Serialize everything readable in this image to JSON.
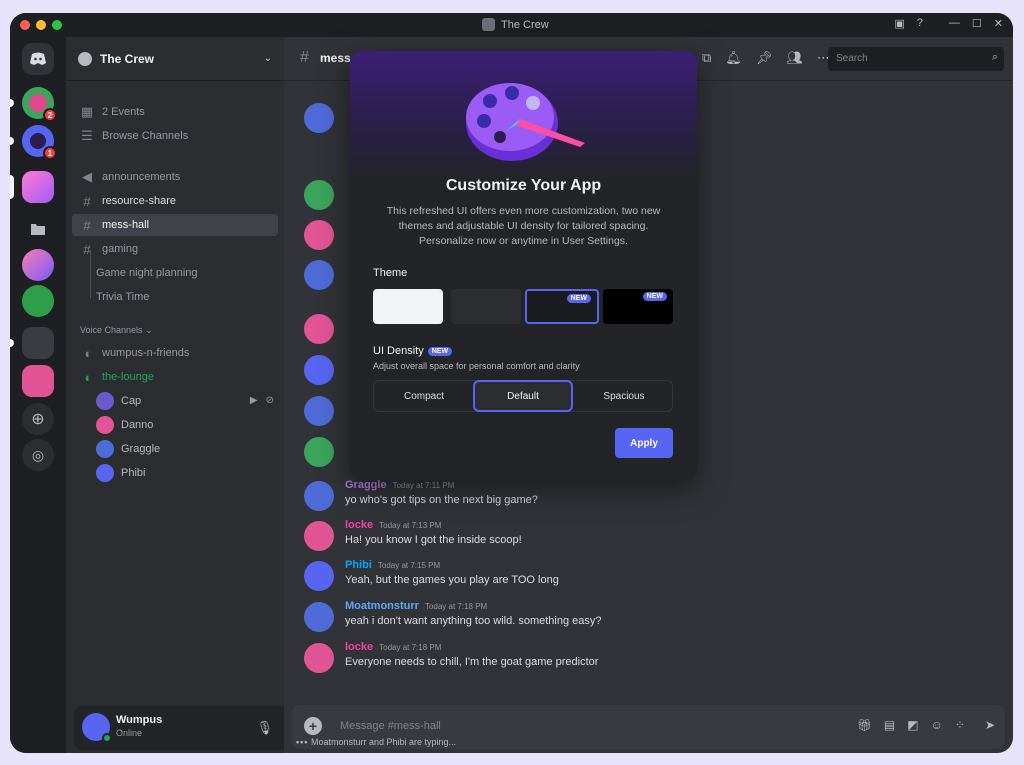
{
  "window": {
    "title": "The Crew"
  },
  "colors": {
    "brand": "#5865f2",
    "online": "#23a55a",
    "mention": "#f23f43"
  },
  "rail": {
    "servers": [
      {
        "name": "home",
        "badge": ""
      },
      {
        "name": "server-1",
        "badge": "2"
      },
      {
        "name": "server-2",
        "badge": "1"
      }
    ]
  },
  "guild": {
    "name": "The Crew",
    "events": "2 Events",
    "browse": "Browse Channels",
    "channels": [
      "announcements",
      "resource-share",
      "mess-hall",
      "gaming"
    ],
    "threads": [
      "Game night planning",
      "Trivia Time"
    ],
    "voice_label": "Voice Channels",
    "voice_channels": [
      "wumpus-n-friends",
      "the-lounge"
    ],
    "voice_users": [
      "Cap",
      "Danno",
      "Graggle",
      "Phibi"
    ]
  },
  "user": {
    "name": "Wumpus",
    "status": "Online"
  },
  "header": {
    "channel": "mess-hall",
    "search_placeholder": "Search"
  },
  "messages": [
    {
      "author": "Graggle",
      "time": "Today at 7:11 PM",
      "text": "yo who's got tips on the next big game?",
      "color": "#b37ee8"
    },
    {
      "author": "locke",
      "time": "Today at 7:13 PM",
      "text": "Ha! you know I got the inside scoop!",
      "color": "#eb459e"
    },
    {
      "author": "Phibi",
      "time": "Today at 7:15 PM",
      "text": "Yeah, but the games you play are TOO long",
      "color": "#00a8fc"
    },
    {
      "author": "Moatmonsturr",
      "time": "Today at 7:18 PM",
      "text": "yeah i don't want anything too wild. something easy?",
      "color": "#5fa8f0"
    },
    {
      "author": "locke",
      "time": "Today at 7:18 PM",
      "text": "Everyone needs to chill, I'm the goat game predictor",
      "color": "#eb459e"
    }
  ],
  "composer": {
    "placeholder": "Message #mess-hall",
    "typing": "Moatmonsturr and Phibi are typing..."
  },
  "modal": {
    "title": "Customize Your App",
    "description": "This refreshed UI offers even more customization, two new themes and adjustable UI density for tailored spacing. Personalize now or anytime in User Settings.",
    "theme_label": "Theme",
    "new_tag": "NEW",
    "density_label": "UI Density",
    "density_sub": "Adjust overall space for personal comfort and clarity",
    "density_options": [
      "Compact",
      "Default",
      "Spacious"
    ],
    "density_selected": "Default",
    "apply": "Apply"
  }
}
